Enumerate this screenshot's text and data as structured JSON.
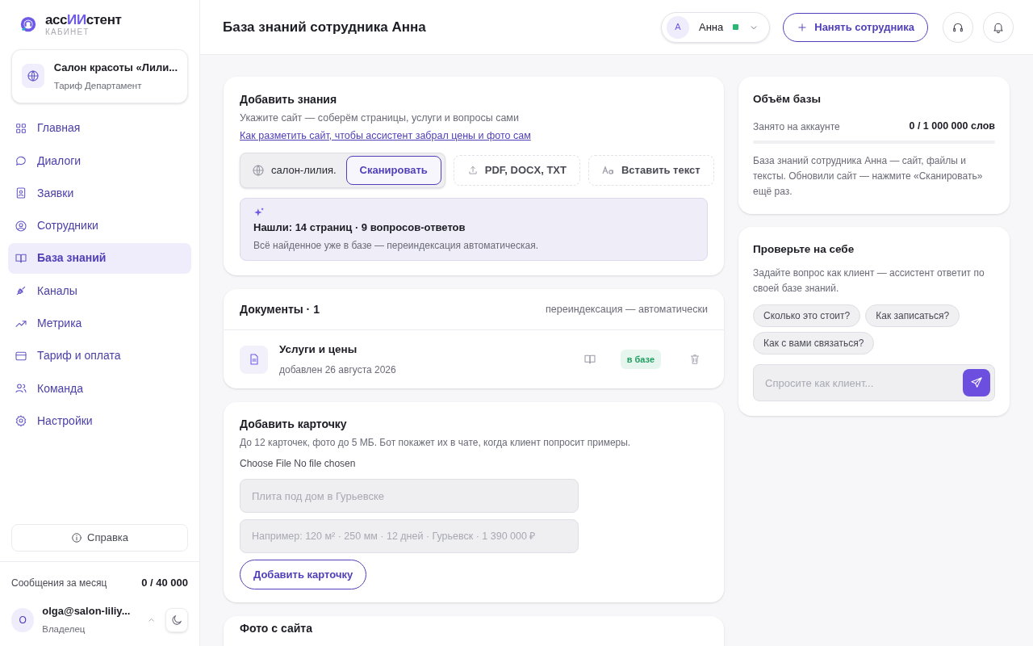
{
  "brand": {
    "name_start": "асс",
    "name_mark": "ИИ",
    "name_end": "стент",
    "subtitle": "КАБИНЕТ"
  },
  "org": {
    "name": "Салон красоты «Лили...",
    "plan": "Тариф Департамент"
  },
  "nav": [
    {
      "label": "Главная",
      "selected": false
    },
    {
      "label": "Диалоги",
      "selected": false
    },
    {
      "label": "Заявки",
      "selected": false
    },
    {
      "label": "Сотрудники",
      "selected": false
    },
    {
      "label": "База знаний",
      "selected": true
    },
    {
      "label": "Каналы",
      "selected": false
    },
    {
      "label": "Метрика",
      "selected": false
    },
    {
      "label": "Тариф и оплата",
      "selected": false
    },
    {
      "label": "Команда",
      "selected": false
    },
    {
      "label": "Настройки",
      "selected": false
    }
  ],
  "help_button": "Справка",
  "messages": {
    "label": "Сообщения за месяц",
    "value": "0 / 40 000"
  },
  "user": {
    "initial": "O",
    "email": "olga@salon-liliy...",
    "role": "Владелец"
  },
  "header": {
    "title": "База знаний сотрудника Анна",
    "employee": {
      "initial": "A",
      "name": "Анна",
      "online": true
    },
    "hire_button": "Нанять сотрудника"
  },
  "add_knowledge": {
    "title": "Добавить знания",
    "subtitle": "Укажите сайт — соберём страницы, услуги и вопросы сами",
    "link": "Как разметить сайт, чтобы ассистент забрал цены и фото сам",
    "site_value": "салон-лилия.",
    "scan_button": "Сканировать",
    "upload_button": "PDF, DOCX, TXT",
    "paste_button": "Вставить текст",
    "result_title": "Нашли: 14 страниц · 9 вопросов-ответов",
    "result_note": "Всё найденное уже в базе — переиндексация автоматическая."
  },
  "documents": {
    "title": "Документы · 1",
    "note": "переиндексация — автоматически",
    "items": [
      {
        "name": "Услуги и цены",
        "date": "добавлен 26 августа 2026",
        "status": "в базе"
      }
    ]
  },
  "add_card": {
    "title": "Добавить карточку",
    "subtitle": "До 12 карточек, фото до 5 МБ. Бот покажет их в чате, когда клиент попросит примеры.",
    "file_label": "Choose File No file chosen",
    "title_placeholder": "Плита под дом в Гурьевске",
    "details_placeholder": "Например: 120 м² · 250 мм · 12 дней · Гурьевск · 1 390 000 ₽",
    "button": "Добавить карточку"
  },
  "site_photos": {
    "title": "Фото с сайта"
  },
  "volume": {
    "title": "Объём базы",
    "label": "Занято на аккаунте",
    "value": "0 / 1 000 000 слов",
    "note": "База знаний сотрудника Анна — сайт, файлы и тексты. Обновили сайт — нажмите «Сканировать» ещё раз."
  },
  "try_it": {
    "title": "Проверьте на себе",
    "subtitle": "Задайте вопрос как клиент — ассистент ответит по своей базе знаний.",
    "chips": [
      "Сколько это стоит?",
      "Как записаться?",
      "Как с вами связаться?"
    ],
    "placeholder": "Спросите как клиент..."
  }
}
